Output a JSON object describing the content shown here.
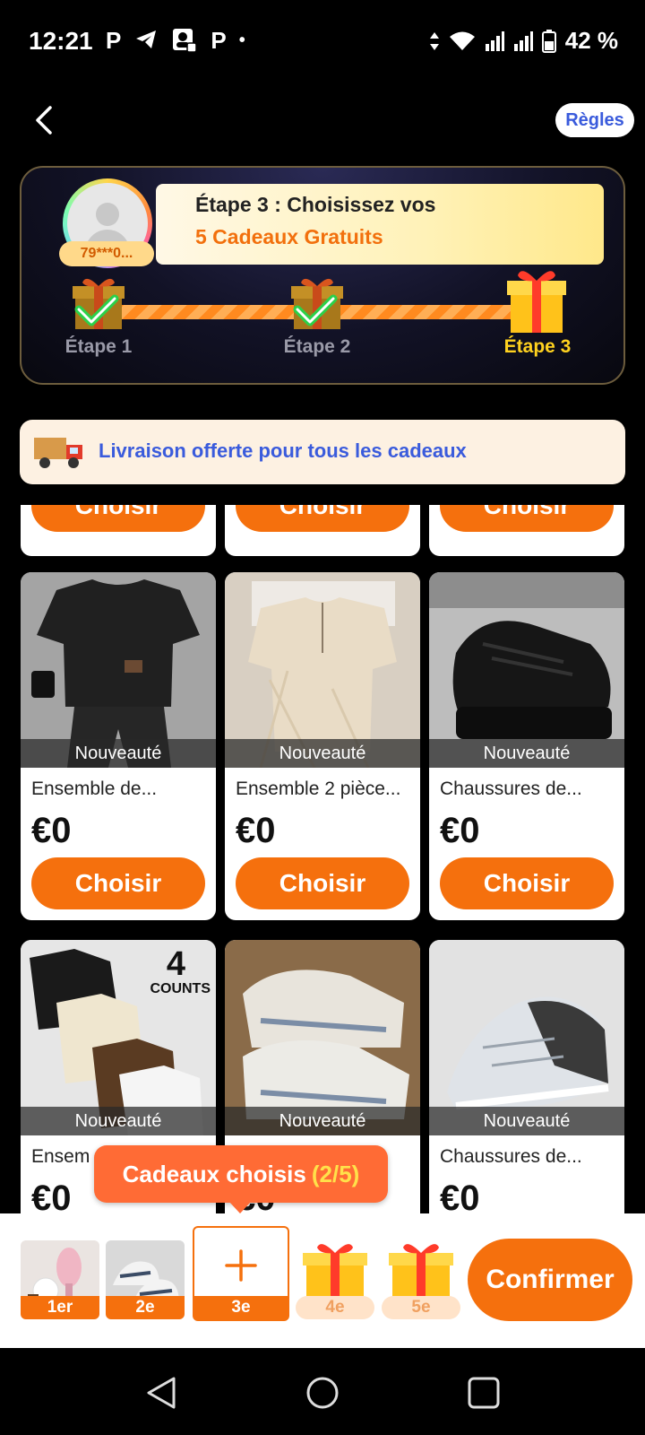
{
  "status_bar": {
    "time": "12:21",
    "left_icons": [
      "parking-app-icon",
      "telegram-icon",
      "contacts-app-icon",
      "parking-app-icon",
      "dot-icon"
    ],
    "battery_text": "42 %"
  },
  "header": {
    "rules_label": "Règles"
  },
  "steps": {
    "user_id": "79***0...",
    "title_line1": "Étape 3 : Choisissez vos",
    "title_line2": "5 Cadeaux Gratuits",
    "labels": [
      "Étape 1",
      "Étape 2",
      "Étape 3"
    ],
    "completed": [
      true,
      true,
      false
    ]
  },
  "shipping": {
    "text": "Livraison offerte pour tous les cadeaux"
  },
  "products": {
    "choose_label": "Choisir",
    "new_tag": "Nouveauté",
    "items": [
      {
        "title": "Ensemble de...",
        "price": "€0"
      },
      {
        "title": "Ensemble 2 pièce...",
        "price": "€0"
      },
      {
        "title": "Chaussures de...",
        "price": "€0"
      },
      {
        "title": "Ensem",
        "price": "€0",
        "badge_count": "4",
        "badge_unit": "COUNTS"
      },
      {
        "title": "",
        "price": "€0"
      },
      {
        "title": "Chaussures de...",
        "price": "€0"
      }
    ]
  },
  "toast": {
    "text": "Cadeaux choisis",
    "count": "(2/5)"
  },
  "selection": {
    "slots": [
      "1er",
      "2e",
      "3e",
      "4e",
      "5e"
    ],
    "confirm_label": "Confirmer"
  }
}
